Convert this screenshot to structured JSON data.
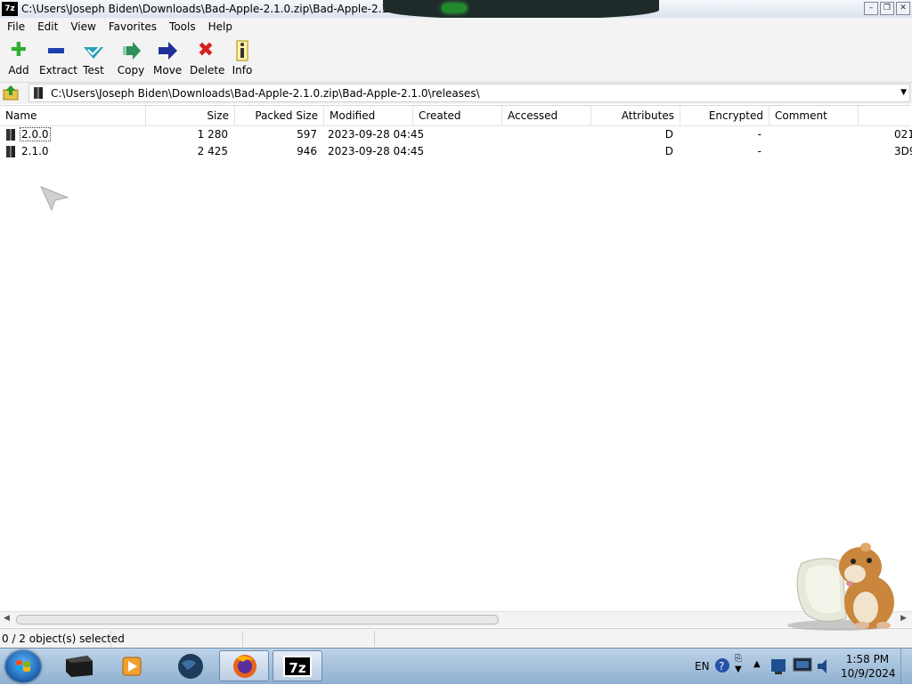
{
  "window": {
    "app_icon": "7z",
    "title": "C:\\Users\\Joseph Biden\\Downloads\\Bad-Apple-2.1.0.zip\\Bad-Apple-2.1.0\\rele...",
    "controls": [
      "minimize",
      "restore",
      "close"
    ]
  },
  "menu": [
    "File",
    "Edit",
    "View",
    "Favorites",
    "Tools",
    "Help"
  ],
  "toolbar": {
    "buttons": [
      {
        "label": "Add",
        "icon": "plus-icon",
        "color": "#2fae2f"
      },
      {
        "label": "Extract",
        "icon": "minus-icon",
        "color": "#1c3fb0"
      },
      {
        "label": "Test",
        "icon": "check-icon",
        "color": "#2aa1b8"
      },
      {
        "label": "Copy",
        "icon": "double-arrow-icon",
        "color": "#2f8f5a"
      },
      {
        "label": "Move",
        "icon": "arrow-right-icon",
        "color": "#1f2f9a"
      },
      {
        "label": "Delete",
        "icon": "x-icon",
        "color": "#d62020"
      },
      {
        "label": "Info",
        "icon": "info-icon",
        "color": "#d8b000"
      }
    ]
  },
  "address": {
    "path": "C:\\Users\\Joseph Biden\\Downloads\\Bad-Apple-2.1.0.zip\\Bad-Apple-2.1.0\\releases\\"
  },
  "columns": [
    "Name",
    "Size",
    "Packed Size",
    "Modified",
    "Created",
    "Accessed",
    "Attributes",
    "Encrypted",
    "Comment",
    ""
  ],
  "files": [
    {
      "name": "2.0.0",
      "size": "1 280",
      "packed": "597",
      "modified": "2023-09-28 04:45",
      "created": "",
      "accessed": "",
      "attributes": "D",
      "encrypted": "-",
      "comment": "",
      "crc": "021"
    },
    {
      "name": "2.1.0",
      "size": "2 425",
      "packed": "946",
      "modified": "2023-09-28 04:45",
      "created": "",
      "accessed": "",
      "attributes": "D",
      "encrypted": "-",
      "comment": "",
      "crc": "3D9"
    }
  ],
  "status": {
    "selection": "0 / 2 object(s) selected"
  },
  "taskbar": {
    "apps": [
      "folder-app",
      "media-player-app",
      "globe-app",
      "firefox-app",
      "7zip-app"
    ],
    "active_app": "7zip-app",
    "active_label": "7z",
    "language": "EN",
    "time": "1:58 PM",
    "date": "10/9/2024"
  }
}
